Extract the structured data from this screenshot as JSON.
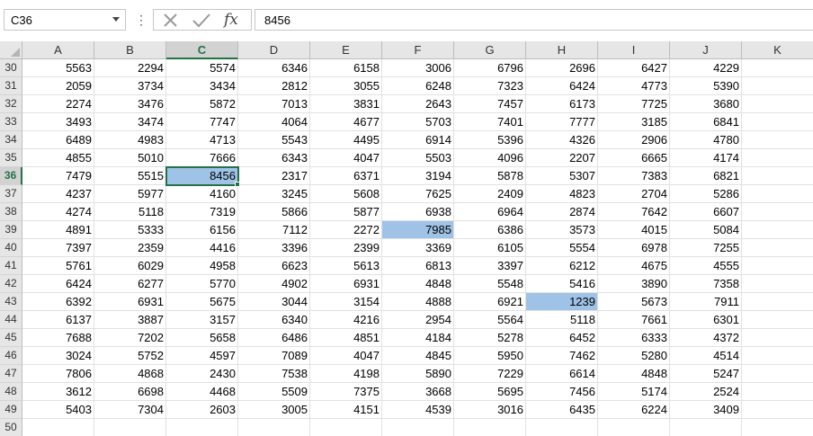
{
  "name_box": {
    "value": "C36"
  },
  "formula_bar": {
    "value": "8456",
    "fx_label": "fx"
  },
  "icons": {
    "cancel": "cancel-x-icon",
    "enter": "enter-check-icon",
    "function": "insert-function-icon",
    "dropdown": "chevron-down-icon"
  },
  "colors": {
    "accent": "#217346",
    "highlight": "#9fc2e7"
  },
  "columns": [
    "A",
    "B",
    "C",
    "D",
    "E",
    "F",
    "G",
    "H",
    "I",
    "J",
    "K"
  ],
  "selected_column": "C",
  "selected_row": "36",
  "active_cell": {
    "row": "36",
    "col": "C"
  },
  "highlighted_cells": [
    {
      "row": "39",
      "col": "F"
    },
    {
      "row": "43",
      "col": "H"
    }
  ],
  "rows": [
    {
      "num": "30",
      "cells": [
        "5563",
        "2294",
        "5574",
        "6346",
        "6158",
        "3006",
        "6796",
        "2696",
        "6427",
        "4229",
        ""
      ]
    },
    {
      "num": "31",
      "cells": [
        "2059",
        "3734",
        "3434",
        "2812",
        "3055",
        "6248",
        "7323",
        "6424",
        "4773",
        "5390",
        ""
      ]
    },
    {
      "num": "32",
      "cells": [
        "2274",
        "3476",
        "5872",
        "7013",
        "3831",
        "2643",
        "7457",
        "6173",
        "7725",
        "3680",
        ""
      ]
    },
    {
      "num": "33",
      "cells": [
        "3493",
        "3474",
        "7747",
        "4064",
        "4677",
        "5703",
        "7401",
        "7777",
        "3185",
        "6841",
        ""
      ]
    },
    {
      "num": "34",
      "cells": [
        "6489",
        "4983",
        "4713",
        "5543",
        "4495",
        "6914",
        "5396",
        "4326",
        "2906",
        "4780",
        ""
      ]
    },
    {
      "num": "35",
      "cells": [
        "4855",
        "5010",
        "7666",
        "6343",
        "4047",
        "5503",
        "4096",
        "2207",
        "6665",
        "4174",
        ""
      ]
    },
    {
      "num": "36",
      "cells": [
        "7479",
        "5515",
        "8456",
        "2317",
        "6371",
        "3194",
        "5878",
        "5307",
        "7383",
        "6821",
        ""
      ]
    },
    {
      "num": "37",
      "cells": [
        "4237",
        "5977",
        "4160",
        "3245",
        "5608",
        "7625",
        "2409",
        "4823",
        "2704",
        "5286",
        ""
      ]
    },
    {
      "num": "38",
      "cells": [
        "4274",
        "5118",
        "7319",
        "5866",
        "5877",
        "6938",
        "6964",
        "2874",
        "7642",
        "6607",
        ""
      ]
    },
    {
      "num": "39",
      "cells": [
        "4891",
        "5333",
        "6156",
        "7112",
        "2272",
        "7985",
        "6386",
        "3573",
        "4015",
        "5084",
        ""
      ]
    },
    {
      "num": "40",
      "cells": [
        "7397",
        "2359",
        "4416",
        "3396",
        "2399",
        "3369",
        "6105",
        "5554",
        "6978",
        "7255",
        ""
      ]
    },
    {
      "num": "41",
      "cells": [
        "5761",
        "6029",
        "4958",
        "6623",
        "5613",
        "6813",
        "3397",
        "6212",
        "4675",
        "4555",
        ""
      ]
    },
    {
      "num": "42",
      "cells": [
        "6424",
        "6277",
        "5770",
        "4902",
        "6931",
        "4848",
        "5548",
        "5416",
        "3890",
        "7358",
        ""
      ]
    },
    {
      "num": "43",
      "cells": [
        "6392",
        "6931",
        "5675",
        "3044",
        "3154",
        "4888",
        "6921",
        "1239",
        "5673",
        "7911",
        ""
      ]
    },
    {
      "num": "44",
      "cells": [
        "6137",
        "3887",
        "3157",
        "6340",
        "4216",
        "2954",
        "5564",
        "5118",
        "7661",
        "6301",
        ""
      ]
    },
    {
      "num": "45",
      "cells": [
        "7688",
        "7202",
        "5658",
        "6486",
        "4851",
        "4184",
        "5278",
        "6452",
        "6333",
        "4372",
        ""
      ]
    },
    {
      "num": "46",
      "cells": [
        "3024",
        "5752",
        "4597",
        "7089",
        "4047",
        "4845",
        "5950",
        "7462",
        "5280",
        "4514",
        ""
      ]
    },
    {
      "num": "47",
      "cells": [
        "7806",
        "4868",
        "2430",
        "7538",
        "4198",
        "5890",
        "7229",
        "6614",
        "4848",
        "5247",
        ""
      ]
    },
    {
      "num": "48",
      "cells": [
        "3612",
        "6698",
        "4468",
        "5509",
        "7375",
        "3668",
        "5695",
        "7456",
        "5174",
        "2524",
        ""
      ]
    },
    {
      "num": "49",
      "cells": [
        "5403",
        "7304",
        "2603",
        "3005",
        "4151",
        "4539",
        "3016",
        "6435",
        "6224",
        "3409",
        ""
      ]
    },
    {
      "num": "50",
      "cells": [
        "",
        "",
        "",
        "",
        "",
        "",
        "",
        "",
        "",
        "",
        ""
      ]
    }
  ]
}
